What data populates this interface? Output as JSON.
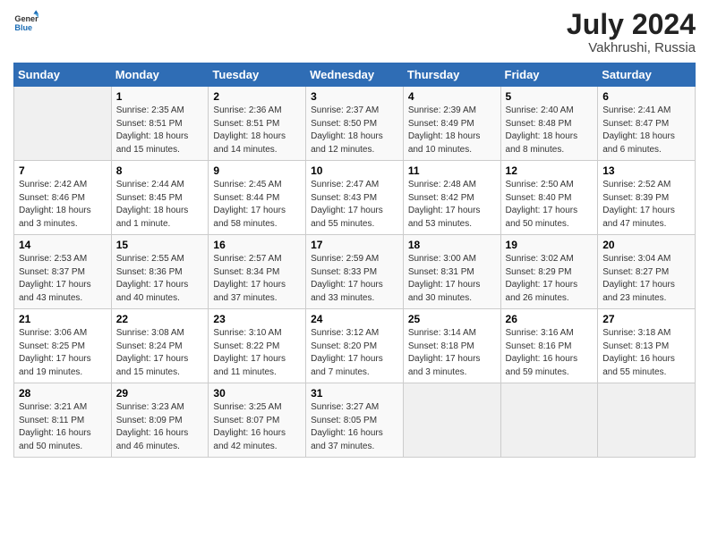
{
  "logo": {
    "general": "General",
    "blue": "Blue"
  },
  "title": {
    "month_year": "July 2024",
    "location": "Vakhrushi, Russia"
  },
  "days_of_week": [
    "Sunday",
    "Monday",
    "Tuesday",
    "Wednesday",
    "Thursday",
    "Friday",
    "Saturday"
  ],
  "weeks": [
    [
      {
        "day": "",
        "info": ""
      },
      {
        "day": "1",
        "info": "Sunrise: 2:35 AM\nSunset: 8:51 PM\nDaylight: 18 hours\nand 15 minutes."
      },
      {
        "day": "2",
        "info": "Sunrise: 2:36 AM\nSunset: 8:51 PM\nDaylight: 18 hours\nand 14 minutes."
      },
      {
        "day": "3",
        "info": "Sunrise: 2:37 AM\nSunset: 8:50 PM\nDaylight: 18 hours\nand 12 minutes."
      },
      {
        "day": "4",
        "info": "Sunrise: 2:39 AM\nSunset: 8:49 PM\nDaylight: 18 hours\nand 10 minutes."
      },
      {
        "day": "5",
        "info": "Sunrise: 2:40 AM\nSunset: 8:48 PM\nDaylight: 18 hours\nand 8 minutes."
      },
      {
        "day": "6",
        "info": "Sunrise: 2:41 AM\nSunset: 8:47 PM\nDaylight: 18 hours\nand 6 minutes."
      }
    ],
    [
      {
        "day": "7",
        "info": "Sunrise: 2:42 AM\nSunset: 8:46 PM\nDaylight: 18 hours\nand 3 minutes."
      },
      {
        "day": "8",
        "info": "Sunrise: 2:44 AM\nSunset: 8:45 PM\nDaylight: 18 hours\nand 1 minute."
      },
      {
        "day": "9",
        "info": "Sunrise: 2:45 AM\nSunset: 8:44 PM\nDaylight: 17 hours\nand 58 minutes."
      },
      {
        "day": "10",
        "info": "Sunrise: 2:47 AM\nSunset: 8:43 PM\nDaylight: 17 hours\nand 55 minutes."
      },
      {
        "day": "11",
        "info": "Sunrise: 2:48 AM\nSunset: 8:42 PM\nDaylight: 17 hours\nand 53 minutes."
      },
      {
        "day": "12",
        "info": "Sunrise: 2:50 AM\nSunset: 8:40 PM\nDaylight: 17 hours\nand 50 minutes."
      },
      {
        "day": "13",
        "info": "Sunrise: 2:52 AM\nSunset: 8:39 PM\nDaylight: 17 hours\nand 47 minutes."
      }
    ],
    [
      {
        "day": "14",
        "info": "Sunrise: 2:53 AM\nSunset: 8:37 PM\nDaylight: 17 hours\nand 43 minutes."
      },
      {
        "day": "15",
        "info": "Sunrise: 2:55 AM\nSunset: 8:36 PM\nDaylight: 17 hours\nand 40 minutes."
      },
      {
        "day": "16",
        "info": "Sunrise: 2:57 AM\nSunset: 8:34 PM\nDaylight: 17 hours\nand 37 minutes."
      },
      {
        "day": "17",
        "info": "Sunrise: 2:59 AM\nSunset: 8:33 PM\nDaylight: 17 hours\nand 33 minutes."
      },
      {
        "day": "18",
        "info": "Sunrise: 3:00 AM\nSunset: 8:31 PM\nDaylight: 17 hours\nand 30 minutes."
      },
      {
        "day": "19",
        "info": "Sunrise: 3:02 AM\nSunset: 8:29 PM\nDaylight: 17 hours\nand 26 minutes."
      },
      {
        "day": "20",
        "info": "Sunrise: 3:04 AM\nSunset: 8:27 PM\nDaylight: 17 hours\nand 23 minutes."
      }
    ],
    [
      {
        "day": "21",
        "info": "Sunrise: 3:06 AM\nSunset: 8:25 PM\nDaylight: 17 hours\nand 19 minutes."
      },
      {
        "day": "22",
        "info": "Sunrise: 3:08 AM\nSunset: 8:24 PM\nDaylight: 17 hours\nand 15 minutes."
      },
      {
        "day": "23",
        "info": "Sunrise: 3:10 AM\nSunset: 8:22 PM\nDaylight: 17 hours\nand 11 minutes."
      },
      {
        "day": "24",
        "info": "Sunrise: 3:12 AM\nSunset: 8:20 PM\nDaylight: 17 hours\nand 7 minutes."
      },
      {
        "day": "25",
        "info": "Sunrise: 3:14 AM\nSunset: 8:18 PM\nDaylight: 17 hours\nand 3 minutes."
      },
      {
        "day": "26",
        "info": "Sunrise: 3:16 AM\nSunset: 8:16 PM\nDaylight: 16 hours\nand 59 minutes."
      },
      {
        "day": "27",
        "info": "Sunrise: 3:18 AM\nSunset: 8:13 PM\nDaylight: 16 hours\nand 55 minutes."
      }
    ],
    [
      {
        "day": "28",
        "info": "Sunrise: 3:21 AM\nSunset: 8:11 PM\nDaylight: 16 hours\nand 50 minutes."
      },
      {
        "day": "29",
        "info": "Sunrise: 3:23 AM\nSunset: 8:09 PM\nDaylight: 16 hours\nand 46 minutes."
      },
      {
        "day": "30",
        "info": "Sunrise: 3:25 AM\nSunset: 8:07 PM\nDaylight: 16 hours\nand 42 minutes."
      },
      {
        "day": "31",
        "info": "Sunrise: 3:27 AM\nSunset: 8:05 PM\nDaylight: 16 hours\nand 37 minutes."
      },
      {
        "day": "",
        "info": ""
      },
      {
        "day": "",
        "info": ""
      },
      {
        "day": "",
        "info": ""
      }
    ]
  ]
}
